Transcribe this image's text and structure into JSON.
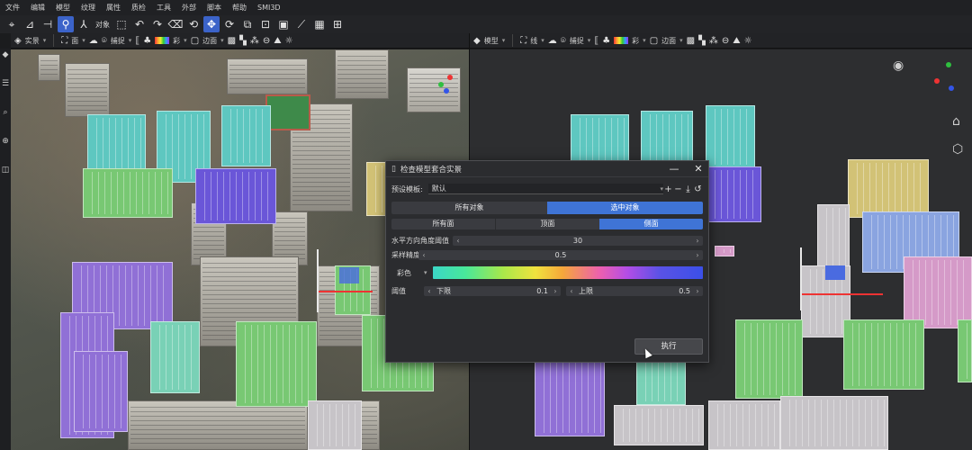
{
  "menu": [
    "文件",
    "编辑",
    "模型",
    "纹理",
    "属性",
    "质检",
    "工具",
    "外部",
    "脚本",
    "帮助",
    "SMI3D"
  ],
  "toolbar": {
    "object_label": "对象",
    "icons": [
      "lasso-icon",
      "polygon-icon",
      "measure-icon",
      "model-icon",
      "axis-icon",
      "select-icon",
      "undo-icon",
      "redo-icon",
      "eraser-icon",
      "rotate-icon",
      "move-icon",
      "refresh-icon",
      "copy-icon",
      "fit-icon",
      "box-icon",
      "ruler-icon",
      "chart-icon",
      "grid-icon"
    ]
  },
  "left_viewport": {
    "mode_label": "实景",
    "shade_label": "面",
    "color_label": "彩",
    "edge_label": "边面",
    "snap_label": "捕捉"
  },
  "right_viewport": {
    "mode_label": "模型",
    "shade_label": "线",
    "color_label": "彩",
    "edge_label": "边面",
    "snap_label": "捕捉"
  },
  "dialog": {
    "title": "检查模型套合实景",
    "preset_label": "预设模板:",
    "preset_value": "默认",
    "object_tabs": [
      "所有对象",
      "选中对象"
    ],
    "object_tab_active": 1,
    "face_tabs": [
      "所有面",
      "顶面",
      "侧面"
    ],
    "face_tab_active": 2,
    "angle_label": "水平方向角度阈值",
    "angle_value": "30",
    "sample_label": "采样精度",
    "sample_value": "0.5",
    "color_label": "彩色",
    "threshold_label": "阈值",
    "lower_label": "下限",
    "lower_value": "0.1",
    "upper_label": "上限",
    "upper_value": "0.5",
    "execute_label": "执行"
  },
  "colors": {
    "accent": "#3f74d6",
    "dialog_bg": "#2b2c2f",
    "viewport_bg": "#2d2e30"
  }
}
